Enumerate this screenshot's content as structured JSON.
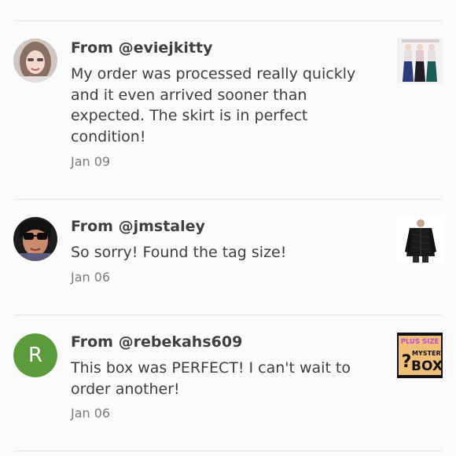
{
  "reviews": [
    {
      "from_prefix": "From ",
      "handle": "@eviejkitty",
      "message": "My order was processed really quickly and it even arrived sooner than expected. The skirt is in perfect condition!",
      "date": "Jan 09",
      "avatar_icon": "user-photo-icon",
      "thumbnail_icon": "skirt-listing-photo-icon"
    },
    {
      "from_prefix": "From ",
      "handle": "@jmstaley",
      "message": "So sorry! Found the tag size!",
      "date": "Jan 06",
      "avatar_icon": "user-photo-icon",
      "thumbnail_icon": "jacket-listing-photo-icon"
    },
    {
      "from_prefix": "From ",
      "handle": "@rebekahs609",
      "message": "This box was PERFECT! I can't wait to order another!",
      "date": "Jan 06",
      "avatar_letter": "R",
      "avatar_color": "#5b9b3c",
      "thumbnail_icon": "mystery-box-listing-photo-icon",
      "thumbnail_text": {
        "top": "PLUS SIZE",
        "mystery": "MYSTERY",
        "box": "BOX",
        "question": "?"
      }
    }
  ]
}
